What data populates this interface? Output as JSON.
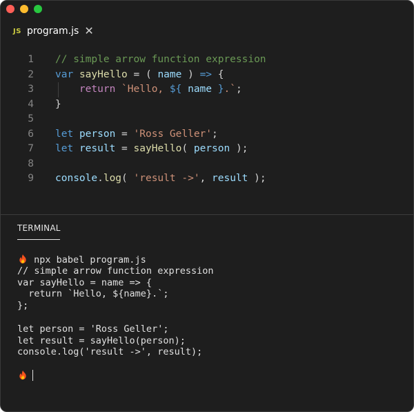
{
  "tab": {
    "icon": "JS",
    "filename": "program.js",
    "close_glyph": "✕"
  },
  "editor": {
    "line_numbers": [
      "1",
      "2",
      "3",
      "4",
      "5",
      "6",
      "7",
      "8",
      "9"
    ],
    "lines": [
      [
        {
          "t": "// simple arrow function expression",
          "c": "comment"
        }
      ],
      [
        {
          "t": "var",
          "c": "kw"
        },
        {
          "t": " ",
          "c": "punc"
        },
        {
          "t": "sayHello",
          "c": "fn"
        },
        {
          "t": " = ( ",
          "c": "punc"
        },
        {
          "t": "name",
          "c": "var"
        },
        {
          "t": " ) ",
          "c": "punc"
        },
        {
          "t": "=>",
          "c": "kw"
        },
        {
          "t": " {",
          "c": "punc"
        }
      ],
      [
        {
          "t": "    ",
          "c": "punc"
        },
        {
          "t": "return",
          "c": "ret"
        },
        {
          "t": " ",
          "c": "punc"
        },
        {
          "t": "`Hello, ",
          "c": "str"
        },
        {
          "t": "${",
          "c": "kw"
        },
        {
          "t": " ",
          "c": "punc"
        },
        {
          "t": "name",
          "c": "var"
        },
        {
          "t": " ",
          "c": "punc"
        },
        {
          "t": "}",
          "c": "kw"
        },
        {
          "t": ".`",
          "c": "str"
        },
        {
          "t": ";",
          "c": "punc"
        }
      ],
      [
        {
          "t": "}",
          "c": "punc"
        }
      ],
      [],
      [
        {
          "t": "let",
          "c": "kw"
        },
        {
          "t": " ",
          "c": "punc"
        },
        {
          "t": "person",
          "c": "var"
        },
        {
          "t": " = ",
          "c": "punc"
        },
        {
          "t": "'Ross Geller'",
          "c": "str"
        },
        {
          "t": ";",
          "c": "punc"
        }
      ],
      [
        {
          "t": "let",
          "c": "kw"
        },
        {
          "t": " ",
          "c": "punc"
        },
        {
          "t": "result",
          "c": "var"
        },
        {
          "t": " = ",
          "c": "punc"
        },
        {
          "t": "sayHello",
          "c": "fn"
        },
        {
          "t": "( ",
          "c": "punc"
        },
        {
          "t": "person",
          "c": "var"
        },
        {
          "t": " );",
          "c": "punc"
        }
      ],
      [],
      [
        {
          "t": "console",
          "c": "var"
        },
        {
          "t": ".",
          "c": "punc"
        },
        {
          "t": "log",
          "c": "fn"
        },
        {
          "t": "( ",
          "c": "punc"
        },
        {
          "t": "'result ->'",
          "c": "str"
        },
        {
          "t": ", ",
          "c": "punc"
        },
        {
          "t": "result",
          "c": "var"
        },
        {
          "t": " );",
          "c": "punc"
        }
      ]
    ]
  },
  "terminal": {
    "tab_label": "TERMINAL",
    "command": "npx babel program.js",
    "output": [
      "// simple arrow function expression",
      "var sayHello = name => {",
      "  return `Hello, ${name}.`;",
      "};",
      "",
      "let person = 'Ross Geller';",
      "let result = sayHello(person);",
      "console.log('result ->', result);",
      ""
    ],
    "prompt_icon": "flame-icon"
  },
  "colors": {
    "background": "#1e1e1e",
    "comment": "#6a9955",
    "keyword": "#569cd6",
    "return": "#c586c0",
    "function": "#dcdcaa",
    "variable": "#9cdcfe",
    "string": "#ce9178"
  }
}
